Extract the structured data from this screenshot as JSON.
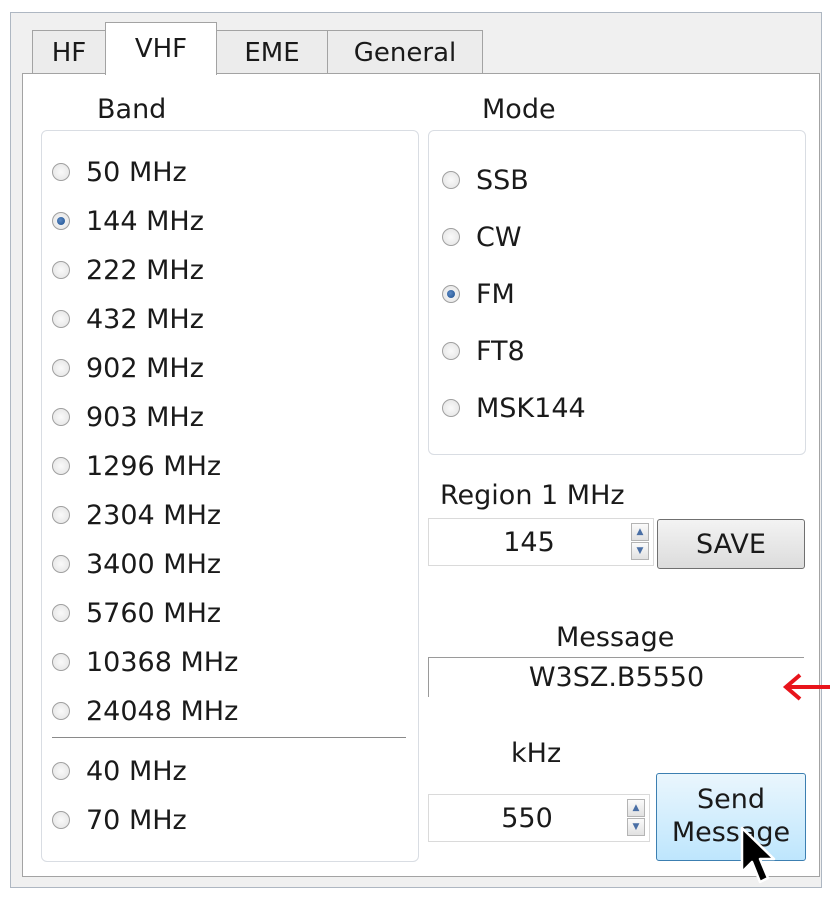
{
  "tabs": [
    {
      "label": "HF",
      "active": false
    },
    {
      "label": "VHF",
      "active": true
    },
    {
      "label": "EME",
      "active": false
    },
    {
      "label": "General",
      "active": false
    }
  ],
  "band": {
    "title": "Band",
    "items": [
      {
        "label": "50 MHz",
        "selected": false
      },
      {
        "label": "144 MHz",
        "selected": true
      },
      {
        "label": "222 MHz",
        "selected": false
      },
      {
        "label": "432 MHz",
        "selected": false
      },
      {
        "label": "902 MHz",
        "selected": false
      },
      {
        "label": "903 MHz",
        "selected": false
      },
      {
        "label": "1296 MHz",
        "selected": false
      },
      {
        "label": "2304 MHz",
        "selected": false
      },
      {
        "label": "3400 MHz",
        "selected": false
      },
      {
        "label": "5760 MHz",
        "selected": false
      },
      {
        "label": "10368 MHz",
        "selected": false
      },
      {
        "label": "24048 MHz",
        "selected": false
      }
    ],
    "extra_items": [
      {
        "label": "40 MHz",
        "selected": false
      },
      {
        "label": "70 MHz",
        "selected": false
      }
    ]
  },
  "mode": {
    "title": "Mode",
    "items": [
      {
        "label": "SSB",
        "selected": false
      },
      {
        "label": "CW",
        "selected": false
      },
      {
        "label": "FM",
        "selected": true
      },
      {
        "label": "FT8",
        "selected": false
      },
      {
        "label": "MSK144",
        "selected": false
      }
    ]
  },
  "region": {
    "label": "Region 1 MHz",
    "value": "145",
    "save_label": "SAVE"
  },
  "message": {
    "label": "Message",
    "value": "W3SZ.B5550"
  },
  "khz": {
    "label": "kHz",
    "value": "550",
    "send_label": "Send Message"
  },
  "icons": {
    "annotation_arrow": "red-arrow-icon",
    "cursor": "mouse-pointer-icon",
    "spin_up": "spin-up-icon",
    "spin_down": "spin-down-icon"
  },
  "colors": {
    "arrow": "#e8141b",
    "hot_button": "#bee6fd",
    "radio_selected": "#1c4f8e"
  }
}
